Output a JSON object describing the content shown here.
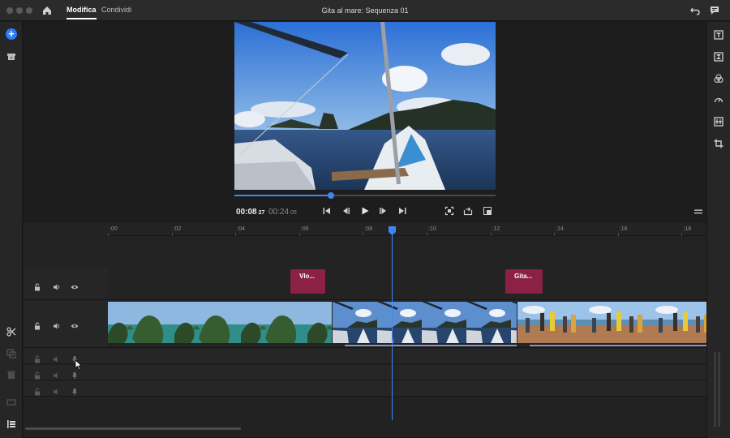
{
  "app": {
    "window_title": "Gita al mare: Sequenza 01",
    "tabs": [
      {
        "label": "Modifica",
        "active": true
      },
      {
        "label": "Condividi",
        "active": false
      }
    ],
    "accent_color": "#2f7bf5"
  },
  "preview": {
    "current_time": "00:08",
    "current_frames": "27",
    "total_time": "00:24",
    "total_frames": "05",
    "progress": 0.37
  },
  "timeline": {
    "ruler_labels": [
      ":00",
      ":02",
      ":04",
      ":06",
      ":08",
      ":10",
      ":12",
      ":14",
      ":16",
      ":18"
    ],
    "title_clips": [
      {
        "label": "Vlo...",
        "color": "#8b2145"
      },
      {
        "label": "Gita...",
        "color": "#8b2145"
      }
    ],
    "video_clips": [
      {
        "name": "islands-clip"
      },
      {
        "name": "boat-clip"
      },
      {
        "name": "beach-clip"
      }
    ],
    "playhead_time": "00:08:27"
  },
  "icons": {
    "top": [
      "home-icon",
      "undo-icon",
      "feedback-icon"
    ],
    "left_rail": [
      "add-icon",
      "archive-icon",
      "scissors-icon",
      "duplicate-icon",
      "trash-icon",
      "caption-icon",
      "tracks-panel-icon"
    ],
    "right_rail": [
      "titles-icon",
      "transitions-icon",
      "color-icon",
      "speed-icon",
      "audio-icon",
      "crop-icon"
    ],
    "transport": [
      "go-to-start-icon",
      "step-back-icon",
      "play-icon",
      "step-forward-icon",
      "go-to-end-icon",
      "fit-icon",
      "export-frame-icon",
      "fullscreen-icon",
      "menu-icon"
    ]
  }
}
